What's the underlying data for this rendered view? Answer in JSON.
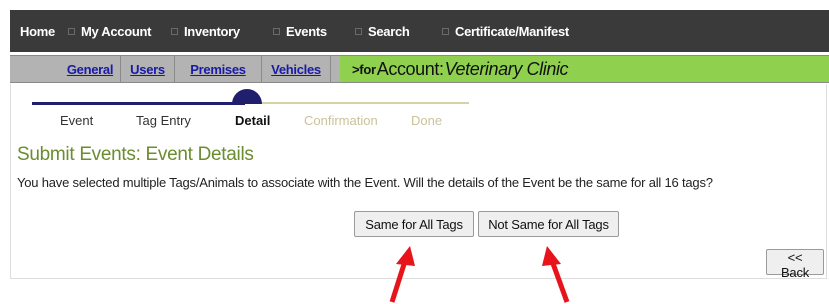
{
  "nav": {
    "items": [
      {
        "label": "Home"
      },
      {
        "label": "My Account"
      },
      {
        "label": "Inventory"
      },
      {
        "label": "Events"
      },
      {
        "label": "Search"
      },
      {
        "label": "Certificate/Manifest"
      }
    ]
  },
  "subnav": {
    "tabs": [
      {
        "label": "General"
      },
      {
        "label": "Users"
      },
      {
        "label": "Premises"
      },
      {
        "label": "Vehicles"
      }
    ],
    "account_prefix": ">for",
    "account_label": "Account:",
    "account_name": "Veterinary Clinic"
  },
  "steps": [
    {
      "label": "Event",
      "state": "done"
    },
    {
      "label": "Tag Entry",
      "state": "done"
    },
    {
      "label": "Detail",
      "state": "current"
    },
    {
      "label": "Confirmation",
      "state": "future"
    },
    {
      "label": "Done",
      "state": "future"
    }
  ],
  "page": {
    "title": "Submit Events: Event Details",
    "message": "You have selected multiple Tags/Animals to associate with the Event. Will the details of the Event be the same for all 16 tags?"
  },
  "buttons": {
    "same": "Same for All Tags",
    "not_same": "Not Same for All Tags",
    "back": "<< Back"
  },
  "annotations": {
    "arrow_color": "#e8141c"
  },
  "colors": {
    "nav_bg": "#3a3a3a",
    "subnav_bg": "#b3b3b3",
    "account_bar_bg": "#8fd14f",
    "title_green": "#6b8c2f",
    "step_done": "#1f1f6e",
    "step_future": "#c9c39a"
  }
}
